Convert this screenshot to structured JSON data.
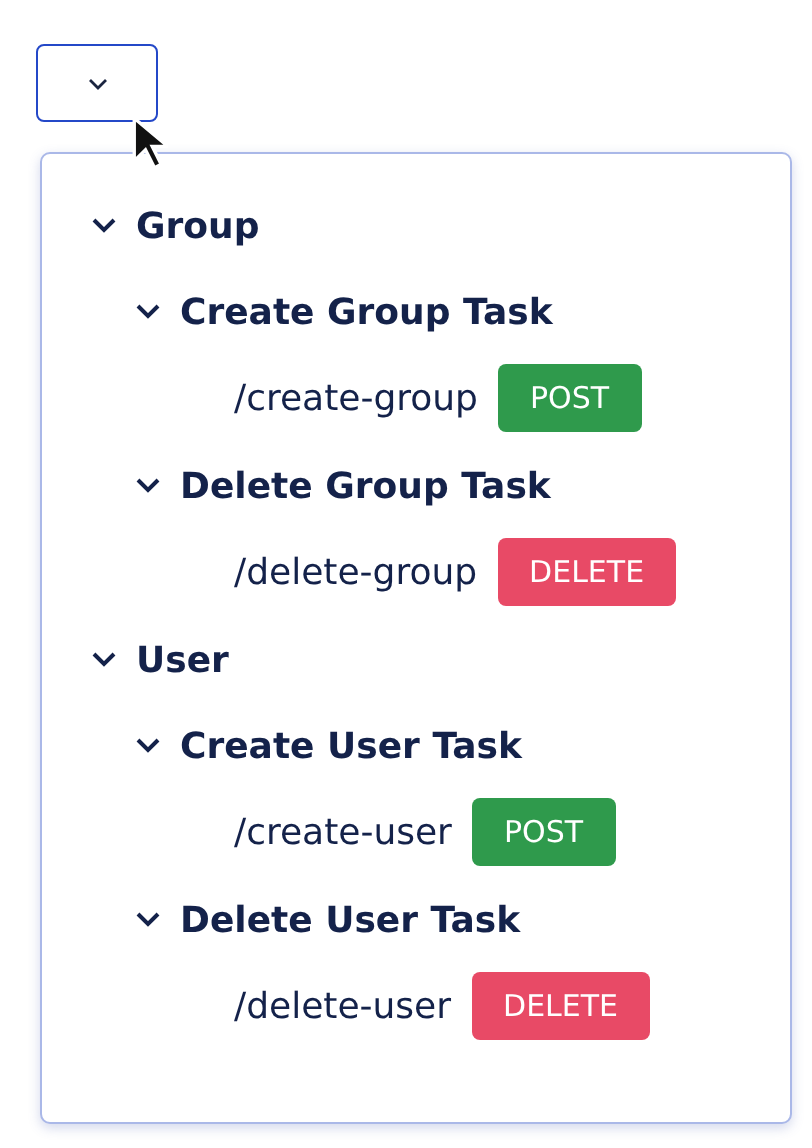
{
  "groups": [
    {
      "label": "Group",
      "expanded": true,
      "tasks": [
        {
          "label": "Create Group Task",
          "expanded": true,
          "endpoint": "/create-group",
          "method": "POST",
          "color": "#2f9a4c"
        },
        {
          "label": "Delete Group Task",
          "expanded": true,
          "endpoint": "/delete-group",
          "method": "DELETE",
          "color": "#e84a66"
        }
      ]
    },
    {
      "label": "User",
      "expanded": true,
      "tasks": [
        {
          "label": "Create User Task",
          "expanded": true,
          "endpoint": "/create-user",
          "method": "POST",
          "color": "#2f9a4c"
        },
        {
          "label": "Delete User Task",
          "expanded": true,
          "endpoint": "/delete-user",
          "method": "DELETE",
          "color": "#e84a66"
        }
      ]
    }
  ]
}
